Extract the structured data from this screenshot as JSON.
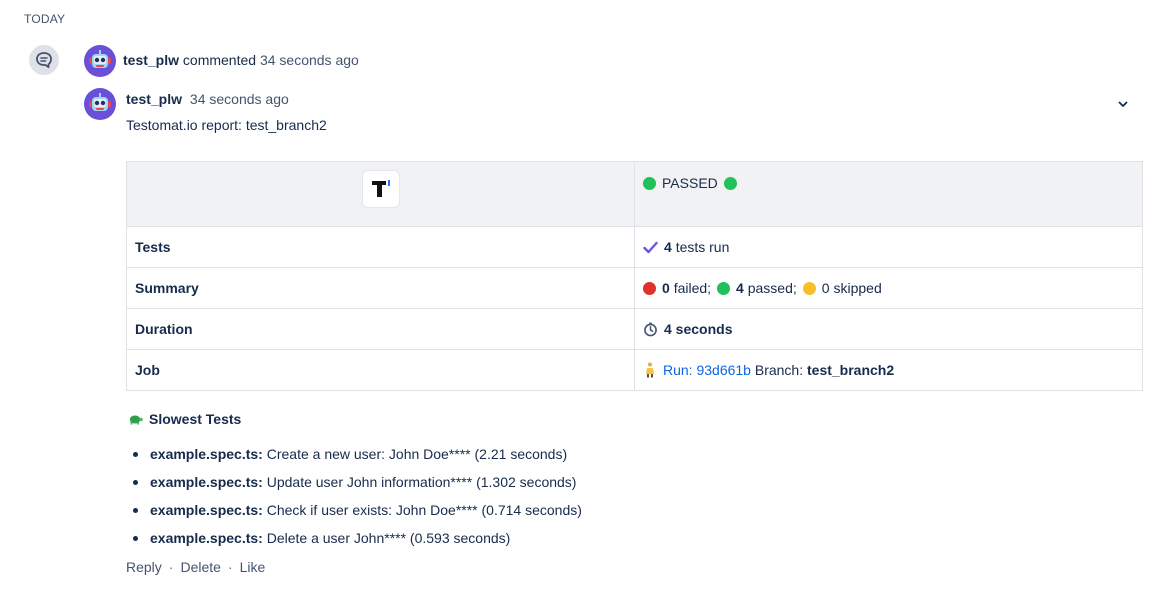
{
  "timeline": {
    "group_label": "TODAY"
  },
  "event": {
    "author": "test_plw",
    "action": "commented",
    "time_ago": "34 seconds ago"
  },
  "comment": {
    "author": "test_plw",
    "time_ago": "34 seconds ago",
    "title": "Testomat.io report: test_branch2",
    "status_label": "PASSED",
    "rows": {
      "tests": {
        "label": "Tests",
        "count": "4",
        "text": "tests run"
      },
      "summary": {
        "label": "Summary",
        "failed_count": "0",
        "failed_text": "failed;",
        "passed_count": "4",
        "passed_text": "passed;",
        "skipped_count": "0",
        "skipped_text": "skipped"
      },
      "duration": {
        "label": "Duration",
        "value": "4 seconds"
      },
      "job": {
        "label": "Job",
        "run_link": "Run: 93d661b",
        "branch_label": "Branch:",
        "branch_value": "test_branch2"
      }
    },
    "slowest_title": "Slowest Tests",
    "slowest_tests": [
      {
        "file": "example.spec.ts:",
        "desc": "Create a new user: John Doe**** (2.21 seconds)"
      },
      {
        "file": "example.spec.ts:",
        "desc": "Update user John information**** (1.302 seconds)"
      },
      {
        "file": "example.spec.ts:",
        "desc": "Check if user exists: John Doe**** (0.714 seconds)"
      },
      {
        "file": "example.spec.ts:",
        "desc": "Delete a user John**** (0.593 seconds)"
      }
    ],
    "actions": {
      "reply": "Reply",
      "delete": "Delete",
      "like": "Like",
      "separator": "·"
    }
  },
  "colors": {
    "passed": "#1fc158",
    "failed": "#e0312b",
    "skipped": "#f6c02a",
    "link": "#0c66e4",
    "check": "#6f53d6",
    "avatar": "#6b4fd8"
  },
  "icons": [
    "comment-icon",
    "robot-avatar-icon",
    "chevron-down-icon",
    "testomat-logo-icon",
    "check-icon",
    "stopwatch-icon",
    "runner-icon",
    "turtle-icon"
  ]
}
